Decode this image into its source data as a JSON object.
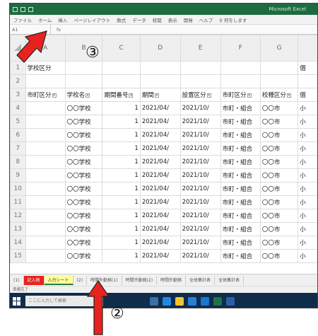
{
  "titlebar": {
    "title": "Microsoft Excel"
  },
  "menubar": {
    "items": [
      "ファイル",
      "ホーム",
      "挿入",
      "ページレイアウト",
      "数式",
      "データ",
      "校閲",
      "表示",
      "開発",
      "ヘルプ",
      "♀ 何をします"
    ]
  },
  "formulabar": {
    "namebox": "A1",
    "fx": "fx"
  },
  "columns": [
    "A",
    "B",
    "C",
    "D",
    "E",
    "F",
    "G"
  ],
  "rows": [
    {
      "n": "1",
      "cells": [
        "学校区分",
        "",
        "",
        "",
        "",
        "",
        "",
        "個"
      ]
    },
    {
      "n": "2",
      "cells": [
        "",
        "",
        "",
        "",
        "",
        "",
        "",
        ""
      ]
    },
    {
      "n": "3",
      "cells": [
        "市町区分",
        "学校名",
        "期間番号",
        "期間",
        "設置区分",
        "市町区分",
        "校種区分",
        "個"
      ]
    },
    {
      "n": "4",
      "cells": [
        "",
        "〇〇学校",
        "1",
        "2021/04/",
        "2021/10/",
        "市町・組合",
        "〇〇市",
        "小"
      ]
    },
    {
      "n": "5",
      "cells": [
        "",
        "〇〇学校",
        "1",
        "2021/04/",
        "2021/10/",
        "市町・組合",
        "〇〇市",
        "小"
      ]
    },
    {
      "n": "6",
      "cells": [
        "",
        "〇〇学校",
        "1",
        "2021/04/",
        "2021/10/",
        "市町・組合",
        "〇〇市",
        "小"
      ]
    },
    {
      "n": "7",
      "cells": [
        "",
        "〇〇学校",
        "1",
        "2021/04/",
        "2021/10/",
        "市町・組合",
        "〇〇市",
        "小"
      ]
    },
    {
      "n": "8",
      "cells": [
        "",
        "〇〇学校",
        "1",
        "2021/04/",
        "2021/10/",
        "市町・組合",
        "〇〇市",
        "小"
      ]
    },
    {
      "n": "9",
      "cells": [
        "",
        "〇〇学校",
        "1",
        "2021/04/",
        "2021/10/",
        "市町・組合",
        "〇〇市",
        "小"
      ]
    },
    {
      "n": "10",
      "cells": [
        "",
        "〇〇学校",
        "1",
        "2021/04/",
        "2021/10/",
        "市町・組合",
        "〇〇市",
        "小"
      ]
    },
    {
      "n": "11",
      "cells": [
        "",
        "〇〇学校",
        "1",
        "2021/04/",
        "2021/10/",
        "市町・組合",
        "〇〇市",
        "小"
      ]
    },
    {
      "n": "12",
      "cells": [
        "",
        "〇〇学校",
        "1",
        "2021/04/",
        "2021/10/",
        "市町・組合",
        "〇〇市",
        "小"
      ]
    },
    {
      "n": "13",
      "cells": [
        "",
        "〇〇学校",
        "1",
        "2021/04/",
        "2021/10/",
        "市町・組合",
        "〇〇市",
        "小"
      ]
    },
    {
      "n": "14",
      "cells": [
        "",
        "〇〇学校",
        "1",
        "2021/04/",
        "2021/10/",
        "市町・組合",
        "〇〇市",
        "小"
      ]
    },
    {
      "n": "15",
      "cells": [
        "",
        "〇〇学校",
        "1",
        "2021/04/",
        "2021/10/",
        "市町・組合",
        "〇〇市",
        "小"
      ]
    }
  ],
  "tabs": [
    {
      "label": "(1)",
      "style": "normal"
    },
    {
      "label": "記入例",
      "style": "red"
    },
    {
      "label": "入力シート",
      "style": "active"
    },
    {
      "label": "(2)",
      "style": "normal"
    },
    {
      "label": "時間外勤務(1)",
      "style": "normal"
    },
    {
      "label": "時間外勤務(2)",
      "style": "normal"
    },
    {
      "label": "時間外勤務",
      "style": "normal"
    },
    {
      "label": "全体集計表",
      "style": "normal"
    },
    {
      "label": "全体集計表",
      "style": "normal"
    }
  ],
  "statusbar": {
    "text": "準備完了"
  },
  "taskbar": {
    "search_placeholder": "ここに入力して検索"
  },
  "annotations": {
    "label3": "③",
    "label2": "②"
  },
  "colors": {
    "excel_green": "#1e6b41",
    "arrow_red": "#e8231f",
    "active_tab": "#ffff99",
    "taskbar": "#0f2c4a"
  }
}
